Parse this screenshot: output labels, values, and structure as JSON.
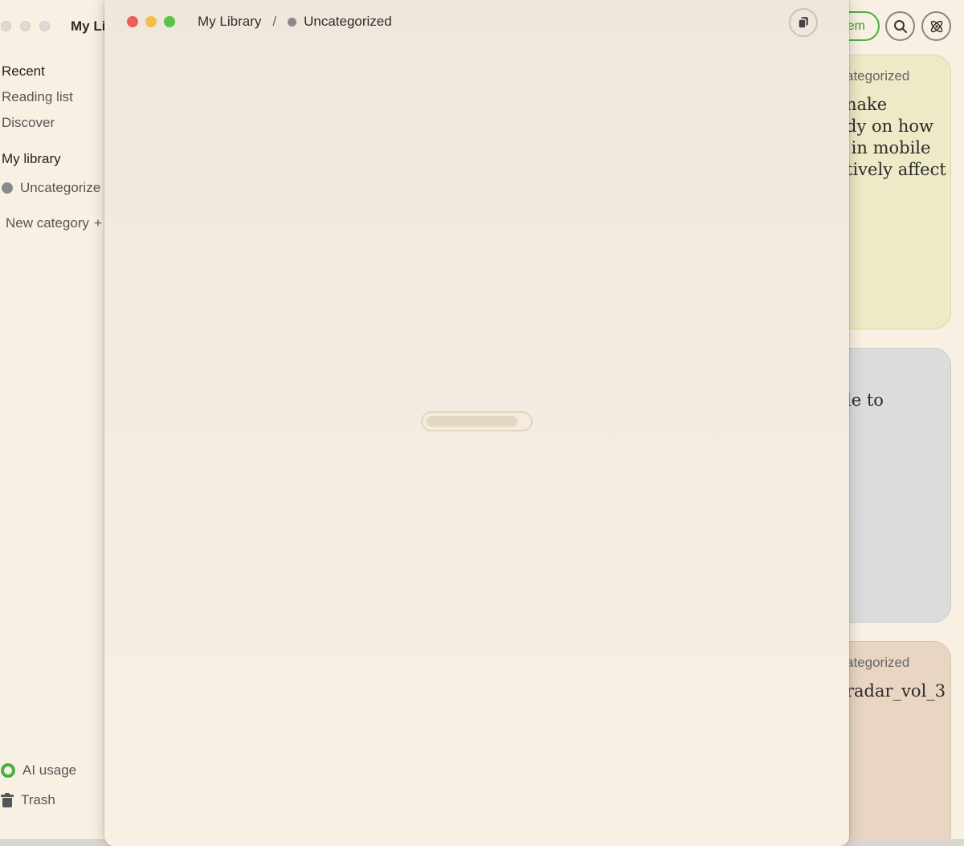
{
  "background_app": {
    "title": "My Li",
    "sidebar": {
      "recent": "Recent",
      "reading_list": "Reading list",
      "discover": "Discover",
      "my_library": "My library",
      "category": "Uncategorize",
      "new_category": "New category",
      "new_category_icon": "+",
      "ai_usage": "AI usage",
      "trash": "Trash"
    },
    "toolbar": {
      "add_item_label": "em"
    },
    "cards": [
      {
        "category": "ategorized",
        "title": "nake\ndy on how\n in mobile\ntively affect",
        "color": "#eee9c6"
      },
      {
        "category": "",
        "title": "le to",
        "color": "#dcdcdc"
      },
      {
        "category": "ategorized",
        "title": "radar_vol_3",
        "color": "#e9d6c2"
      }
    ]
  },
  "foreground_window": {
    "breadcrumb": {
      "root": "My Library",
      "separator": "/",
      "current": "Uncategorized"
    },
    "loading": {
      "progress": 0.82
    }
  },
  "colors": {
    "accent_green": "#4caf3f",
    "close": "#ec5f56",
    "minimize": "#f4bd4f",
    "maximize": "#58c444",
    "category_dot": "#8a8a8a"
  }
}
